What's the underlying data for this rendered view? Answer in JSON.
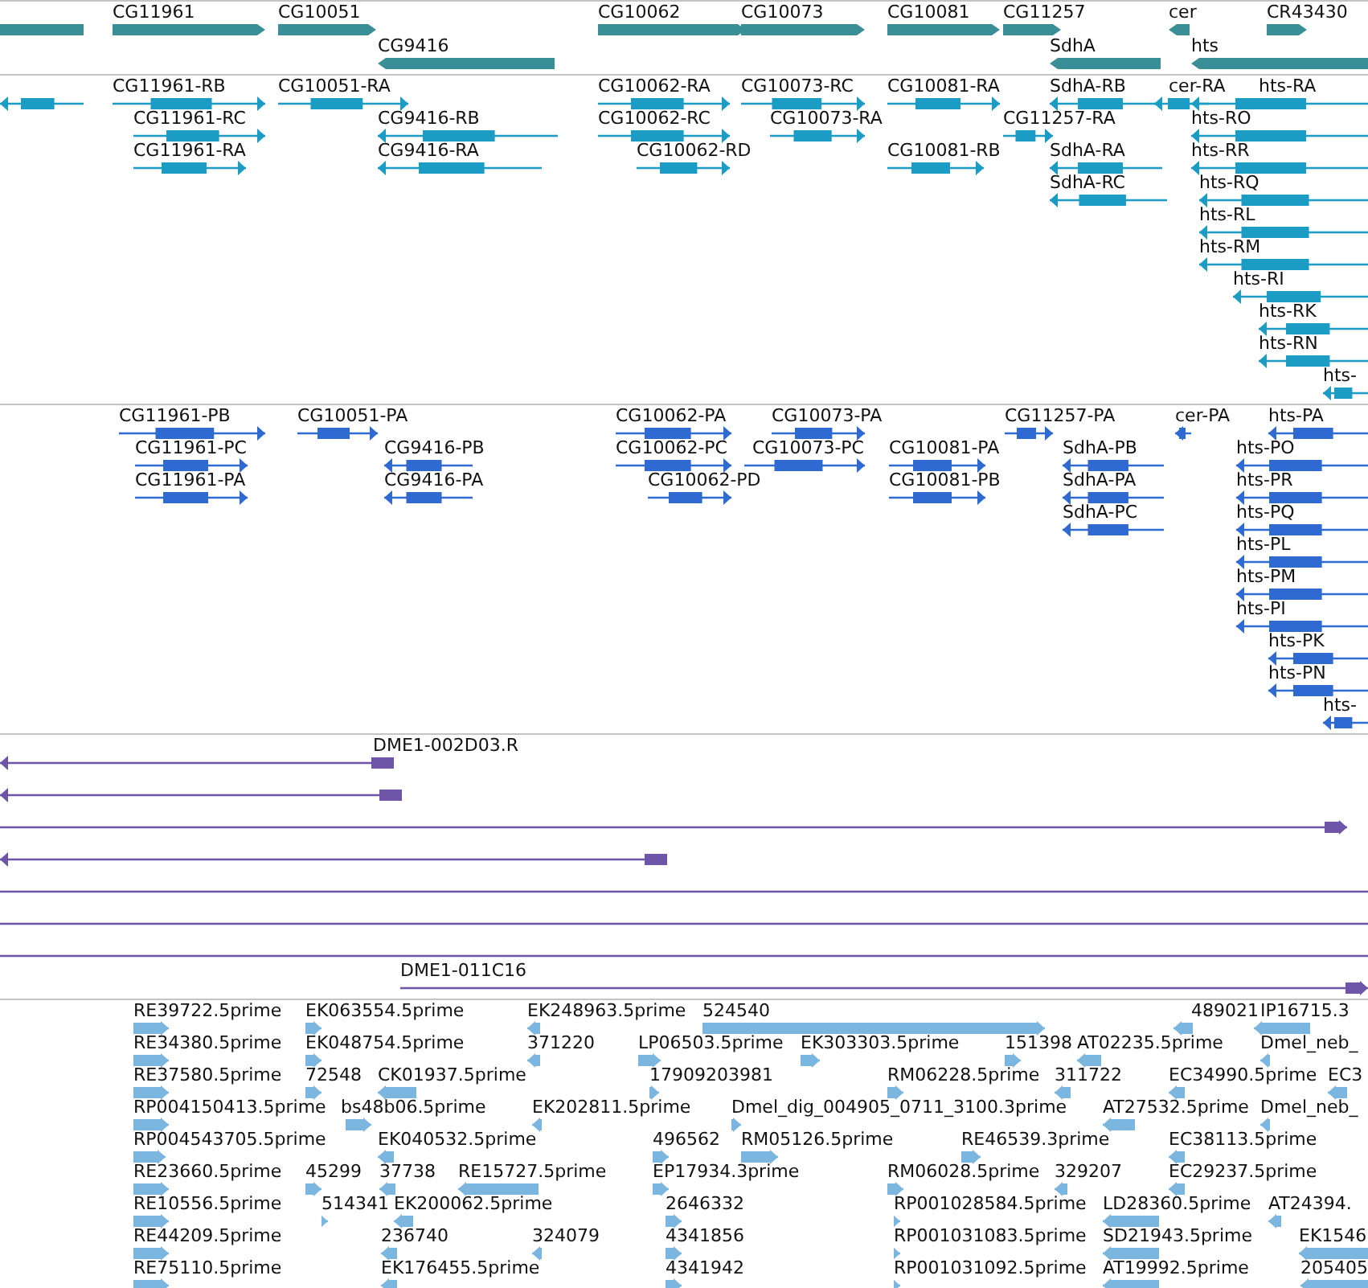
{
  "tracks": [
    {
      "kind": "gene",
      "color": "#3a8e96",
      "features": [
        {
          "clipped": true
        },
        {
          "label": "CG11961",
          "reverse": false
        },
        {
          "label": "CG10051",
          "reverse": false
        },
        {
          "label": "CG10062",
          "reverse": false
        },
        {
          "label": "CG10073",
          "reverse": false
        },
        {
          "label": "CG10081",
          "reverse": false
        },
        {
          "label": "CG11257",
          "reverse": false
        },
        {
          "label": "cer",
          "reverse": true
        },
        {
          "label": "CR43430",
          "reverse": false
        },
        {
          "label": "CG9416",
          "reverse": true
        },
        {
          "label": "SdhA",
          "reverse": true
        },
        {
          "label": "hts",
          "reverse": true
        }
      ]
    },
    {
      "kind": "transcript",
      "color": "#1a9cc4",
      "features": [
        {
          "reverse": true
        },
        {
          "label": "CG11961-RB",
          "reverse": false
        },
        {
          "label": "CG10051-RA",
          "reverse": false
        },
        {
          "label": "CG10062-RA",
          "reverse": false
        },
        {
          "label": "CG10073-RC",
          "reverse": false
        },
        {
          "label": "CG10081-RA",
          "reverse": false
        },
        {
          "label": "SdhA-RB",
          "reverse": true
        },
        {
          "label": "cer-RA",
          "reverse": true
        },
        {
          "label": "hts-RA",
          "reverse": true
        },
        {
          "label": "CG11961-RC",
          "reverse": false
        },
        {
          "label": "CG9416-RB",
          "reverse": true
        },
        {
          "label": "CG10062-RC",
          "reverse": false
        },
        {
          "label": "CG10073-RA",
          "reverse": false
        },
        {
          "label": "CG11257-RA",
          "reverse": false
        },
        {
          "label": "hts-RO",
          "reverse": true
        },
        {
          "label": "CG11961-RA",
          "reverse": false
        },
        {
          "label": "CG9416-RA",
          "reverse": true
        },
        {
          "label": "CG10062-RD",
          "reverse": false
        },
        {
          "label": "CG10081-RB",
          "reverse": false
        },
        {
          "label": "SdhA-RA",
          "reverse": true
        },
        {
          "label": "hts-RR",
          "reverse": true
        },
        {
          "label": "SdhA-RC",
          "reverse": true
        },
        {
          "label": "hts-RQ",
          "reverse": true
        },
        {
          "label": "hts-RL",
          "reverse": true
        },
        {
          "label": "hts-RM",
          "reverse": true
        },
        {
          "label": "hts-RI",
          "reverse": true
        },
        {
          "label": "hts-RK",
          "reverse": true
        },
        {
          "label": "hts-RN",
          "reverse": true
        },
        {
          "label": "hts-",
          "reverse": true
        }
      ]
    },
    {
      "kind": "protein",
      "color": "#2e6ad1",
      "features": [
        {
          "label": "CG11961-PB",
          "reverse": false
        },
        {
          "label": "CG10051-PA",
          "reverse": false
        },
        {
          "label": "CG10062-PA",
          "reverse": false
        },
        {
          "label": "CG10073-PA",
          "reverse": false
        },
        {
          "label": "CG11257-PA",
          "reverse": false
        },
        {
          "label": "cer-PA",
          "reverse": true
        },
        {
          "label": "hts-PA",
          "reverse": true
        },
        {
          "label": "CG11961-PC",
          "reverse": false
        },
        {
          "label": "CG9416-PB",
          "reverse": true
        },
        {
          "label": "CG10062-PC",
          "reverse": false
        },
        {
          "label": "CG10073-PC",
          "reverse": false
        },
        {
          "label": "CG10081-PA",
          "reverse": false
        },
        {
          "label": "SdhA-PB",
          "reverse": true
        },
        {
          "label": "hts-PO",
          "reverse": true
        },
        {
          "label": "CG11961-PA",
          "reverse": false
        },
        {
          "label": "CG9416-PA",
          "reverse": true
        },
        {
          "label": "CG10062-PD",
          "reverse": false
        },
        {
          "label": "CG10081-PB",
          "reverse": false
        },
        {
          "label": "SdhA-PA",
          "reverse": true
        },
        {
          "label": "hts-PR",
          "reverse": true
        },
        {
          "label": "SdhA-PC",
          "reverse": true
        },
        {
          "label": "hts-PQ",
          "reverse": true
        },
        {
          "label": "hts-PL",
          "reverse": true
        },
        {
          "label": "hts-PM",
          "reverse": true
        },
        {
          "label": "hts-PI",
          "reverse": true
        },
        {
          "label": "hts-PK",
          "reverse": true
        },
        {
          "label": "hts-PN",
          "reverse": true
        },
        {
          "label": "hts-",
          "reverse": true
        }
      ]
    },
    {
      "kind": "alignment",
      "color": "#6f55a8",
      "features": [
        {
          "label": "DME1-002D03.R",
          "reverse": true
        },
        {
          "reverse": true
        },
        {
          "reverse": false
        },
        {
          "reverse": true
        },
        {
          "clipped": true
        },
        {
          "clipped": true
        },
        {
          "clipped": true
        },
        {
          "label": "DME1-011C16",
          "reverse": false
        }
      ]
    },
    {
      "kind": "read",
      "color": "#7bb6e0",
      "features": [
        {
          "label": "RE39722.5prime",
          "reverse": false
        },
        {
          "label": "EK063554.5prime",
          "reverse": false
        },
        {
          "label": "EK248963.5prime",
          "reverse": true
        },
        {
          "label": "524540",
          "reverse": false
        },
        {
          "label": "489021",
          "reverse": true
        },
        {
          "label": "IP16715.3",
          "reverse": true
        },
        {
          "label": "RE34380.5prime",
          "reverse": false
        },
        {
          "label": "EK048754.5prime",
          "reverse": false
        },
        {
          "label": "371220",
          "reverse": true
        },
        {
          "label": "LP06503.5prime",
          "reverse": false
        },
        {
          "label": "EK303303.5prime",
          "reverse": false
        },
        {
          "label": "151398",
          "reverse": false
        },
        {
          "label": "AT02235.5prime",
          "reverse": true
        },
        {
          "label": "Dmel_neb_",
          "reverse": true
        },
        {
          "label": "RE37580.5prime",
          "reverse": false
        },
        {
          "label": "72548",
          "reverse": false
        },
        {
          "label": "CK01937.5prime",
          "reverse": true
        },
        {
          "label": "17909203981",
          "reverse": false
        },
        {
          "label": "RM06228.5prime",
          "reverse": false
        },
        {
          "label": "311722",
          "reverse": true
        },
        {
          "label": "EC34990.5prime",
          "reverse": true
        },
        {
          "label": "EC3",
          "reverse": true
        },
        {
          "label": "RP004150413.5prime",
          "reverse": false
        },
        {
          "label": "bs48b06.5prime",
          "reverse": false
        },
        {
          "label": "EK202811.5prime",
          "reverse": true
        },
        {
          "label": "Dmel_dig_004905_0711_3100.3prime",
          "reverse": false
        },
        {
          "label": "AT27532.5prime",
          "reverse": true
        },
        {
          "label": "Dmel_neb_",
          "reverse": true
        },
        {
          "label": "RP004543705.5prime",
          "reverse": false
        },
        {
          "label": "EK040532.5prime",
          "reverse": true
        },
        {
          "label": "496562",
          "reverse": false
        },
        {
          "label": "RM05126.5prime",
          "reverse": false
        },
        {
          "label": "RE46539.3prime",
          "reverse": false
        },
        {
          "label": "EC38113.5prime",
          "reverse": true
        },
        {
          "label": "RE23660.5prime",
          "reverse": false
        },
        {
          "label": "45299",
          "reverse": false
        },
        {
          "label": "37738",
          "reverse": true
        },
        {
          "label": "RE15727.5prime",
          "reverse": true
        },
        {
          "label": "EP17934.3prime",
          "reverse": false
        },
        {
          "label": "RM06028.5prime",
          "reverse": false
        },
        {
          "label": "329207",
          "reverse": true
        },
        {
          "label": "EC29237.5prime",
          "reverse": true
        },
        {
          "label": "RE10556.5prime",
          "reverse": false
        },
        {
          "label": "514341",
          "reverse": false
        },
        {
          "label": "EK200062.5prime",
          "reverse": true
        },
        {
          "label": "2646332",
          "reverse": false
        },
        {
          "label": "RP001028584.5prime",
          "reverse": false
        },
        {
          "label": "LD28360.5prime",
          "reverse": true
        },
        {
          "label": "AT24394.",
          "reverse": true
        },
        {
          "label": "RE44209.5prime",
          "reverse": false
        },
        {
          "label": "236740",
          "reverse": true
        },
        {
          "label": "324079",
          "reverse": true
        },
        {
          "label": "4341856",
          "reverse": false
        },
        {
          "label": "RP001031083.5prime",
          "reverse": false
        },
        {
          "label": "SD21943.5prime",
          "reverse": true
        },
        {
          "label": "EK1546",
          "reverse": true
        },
        {
          "label": "RE75110.5prime",
          "reverse": false
        },
        {
          "label": "EK176455.5prime",
          "reverse": true
        },
        {
          "label": "4341942",
          "reverse": false
        },
        {
          "label": "RP001031092.5prime",
          "reverse": false
        },
        {
          "label": "AT19992.5prime",
          "reverse": true
        },
        {
          "label": "205405",
          "reverse": true
        }
      ]
    }
  ]
}
